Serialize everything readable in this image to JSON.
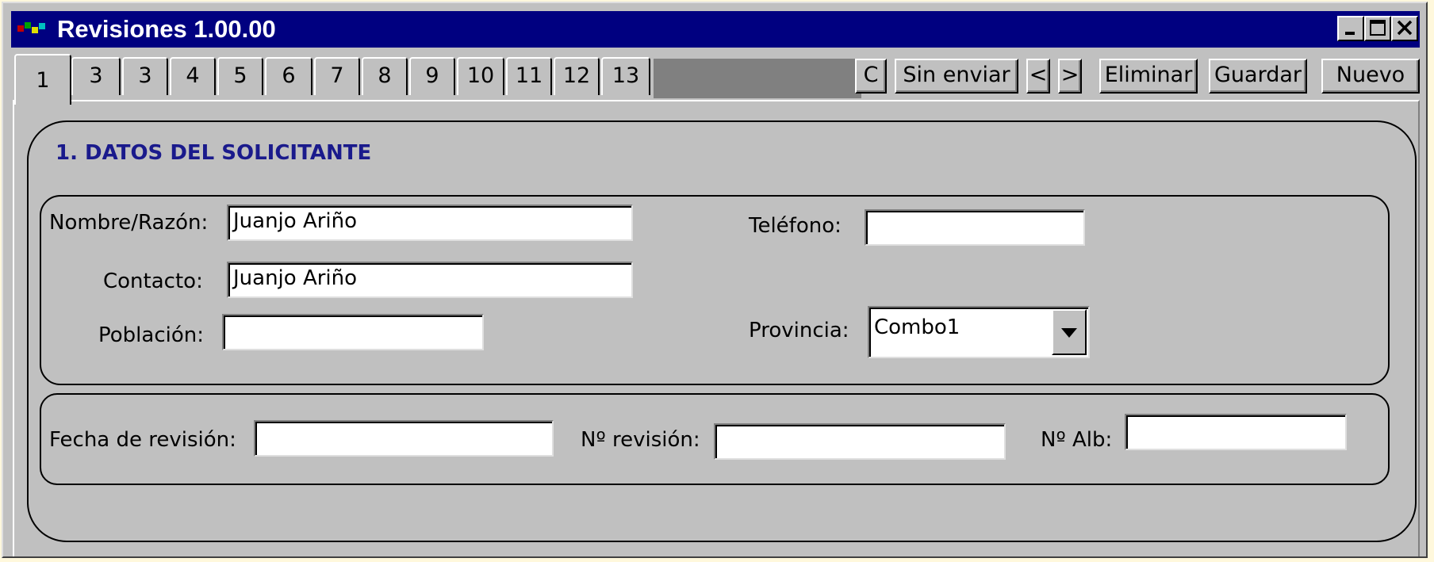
{
  "window": {
    "title": "Revisiones 1.00.00",
    "controls": [
      "minimize-icon",
      "maximize-icon",
      "close-icon"
    ]
  },
  "tabs": [
    "1",
    "3",
    "3",
    "4",
    "5",
    "6",
    "7",
    "8",
    "9",
    "10",
    "11",
    "12",
    "13"
  ],
  "toolbar": {
    "c_label": "C",
    "sin_enviar_label": "Sin enviar",
    "prev_label": "<",
    "next_label": ">",
    "eliminar_label": "Eliminar",
    "guardar_label": "Guardar",
    "nuevo_label": "Nuevo"
  },
  "section": {
    "title": "1. DATOS DEL SOLICITANTE"
  },
  "form": {
    "nombre_label": "Nombre/Razón:",
    "nombre_value": "Juanjo Ariño",
    "telefono_label": "Teléfono:",
    "telefono_value": "",
    "contacto_label": "Contacto:",
    "contacto_value": "Juanjo Ariño",
    "poblacion_label": "Población:",
    "poblacion_value": "",
    "provincia_label": "Provincia:",
    "provincia_value": "Combo1",
    "fecha_label": "Fecha de revisión:",
    "fecha_value": "",
    "num_revision_label": "Nº revisión:",
    "num_revision_value": "",
    "num_alb_label": "Nº Alb:",
    "num_alb_value": ""
  },
  "colors": {
    "titlebar": "#000080",
    "section_title": "#1a1a8c",
    "window_face": "#c0c0c0",
    "desktop": "#fff8dc"
  }
}
